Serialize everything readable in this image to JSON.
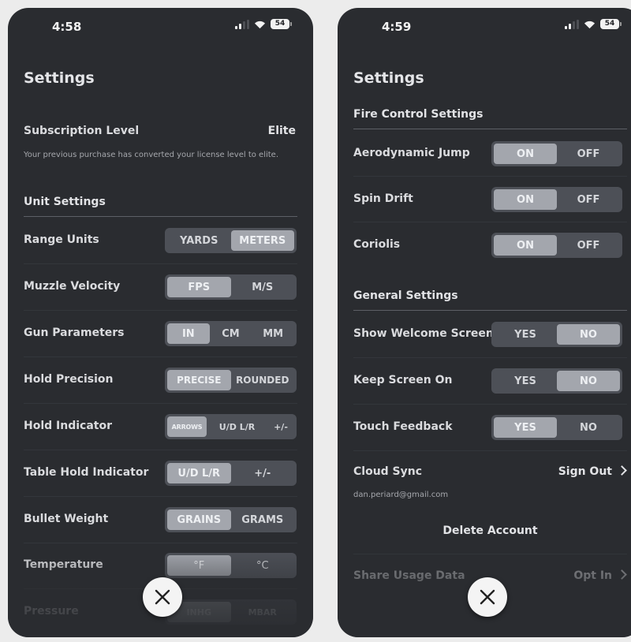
{
  "left": {
    "status": {
      "time": "4:58",
      "battery": "54"
    },
    "title": "Settings",
    "subscription": {
      "label": "Subscription Level",
      "value": "Elite",
      "note": "Your previous purchase has converted your license level to elite."
    },
    "unit_settings": {
      "header": "Unit Settings",
      "rows": [
        {
          "label": "Range Units",
          "options": [
            "YARDS",
            "METERS"
          ],
          "selected": "METERS"
        },
        {
          "label": "Muzzle Velocity",
          "options": [
            "FPS",
            "M/S"
          ],
          "selected": "FPS"
        },
        {
          "label": "Gun Parameters",
          "options": [
            "IN",
            "CM",
            "MM"
          ],
          "selected": "IN"
        },
        {
          "label": "Hold Precision",
          "options": [
            "PRECISE",
            "ROUNDED"
          ],
          "selected": "PRECISE"
        },
        {
          "label": "Hold Indicator",
          "options": [
            "ARROWS",
            "U/D L/R",
            "+/-"
          ],
          "selected": "ARROWS"
        },
        {
          "label": "Table Hold Indicator",
          "options": [
            "U/D L/R",
            "+/-"
          ],
          "selected": "U/D L/R"
        },
        {
          "label": "Bullet Weight",
          "options": [
            "GRAINS",
            "GRAMS"
          ],
          "selected": "GRAINS"
        },
        {
          "label": "Temperature",
          "options": [
            "°F",
            "°C"
          ],
          "selected": "°F"
        },
        {
          "label": "Pressure",
          "options": [
            "INHG",
            "MBAR"
          ],
          "selected": "INHG"
        }
      ]
    }
  },
  "right": {
    "status": {
      "time": "4:59",
      "battery": "54"
    },
    "title": "Settings",
    "fire_control": {
      "header": "Fire Control Settings",
      "rows": [
        {
          "label": "Aerodynamic Jump",
          "options": [
            "ON",
            "OFF"
          ],
          "selected": "ON"
        },
        {
          "label": "Spin Drift",
          "options": [
            "ON",
            "OFF"
          ],
          "selected": "ON"
        },
        {
          "label": "Coriolis",
          "options": [
            "ON",
            "OFF"
          ],
          "selected": "ON"
        }
      ]
    },
    "general": {
      "header": "General Settings",
      "rows": [
        {
          "label": "Show Welcome Screen",
          "options": [
            "YES",
            "NO"
          ],
          "selected": "NO"
        },
        {
          "label": "Keep Screen On",
          "options": [
            "YES",
            "NO"
          ],
          "selected": "NO"
        },
        {
          "label": "Touch Feedback",
          "options": [
            "YES",
            "NO"
          ],
          "selected": "YES"
        }
      ]
    },
    "cloud_sync": {
      "label": "Cloud Sync",
      "action": "Sign Out",
      "email": "dan.periard@gmail.com"
    },
    "delete_account": "Delete Account",
    "share_usage": {
      "label": "Share Usage Data",
      "action": "Opt In"
    }
  },
  "icons": {
    "close": "close-icon",
    "chevron": "chevron-right-icon",
    "signal": "signal-icon",
    "wifi": "wifi-icon",
    "battery": "battery-icon"
  },
  "colors": {
    "background": "#2a2c30",
    "toggle_track": "#4d5057",
    "toggle_selected": "#a3a6ad"
  }
}
